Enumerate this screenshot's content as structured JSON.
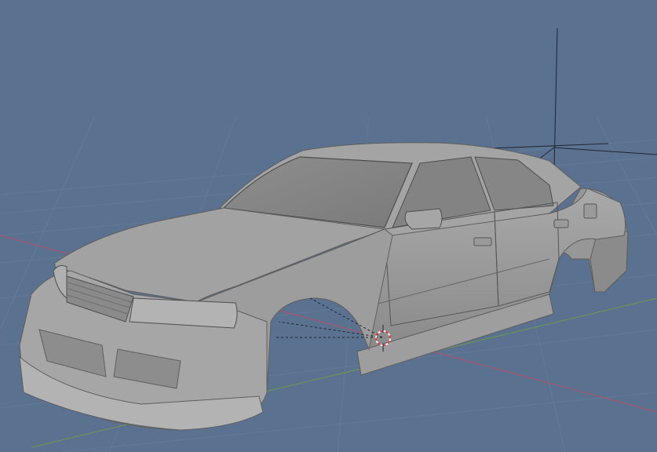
{
  "viewport": {
    "mode": "3d-viewport",
    "shading": "solid",
    "background_color": "#5b7190",
    "grid_line_color": "#6a7f9c",
    "x_axis_color": "#b5506a",
    "y_axis_color": "#6f9a4c",
    "model_color": "#9c9c9c"
  },
  "objects": [
    {
      "name": "car-body-shell",
      "icon": "car-body-mesh",
      "selected": false
    },
    {
      "name": "light",
      "icon": "light-cross-icon",
      "selected": false
    },
    {
      "name": "3d-cursor",
      "icon": "3d-cursor-icon",
      "selected": false
    }
  ]
}
